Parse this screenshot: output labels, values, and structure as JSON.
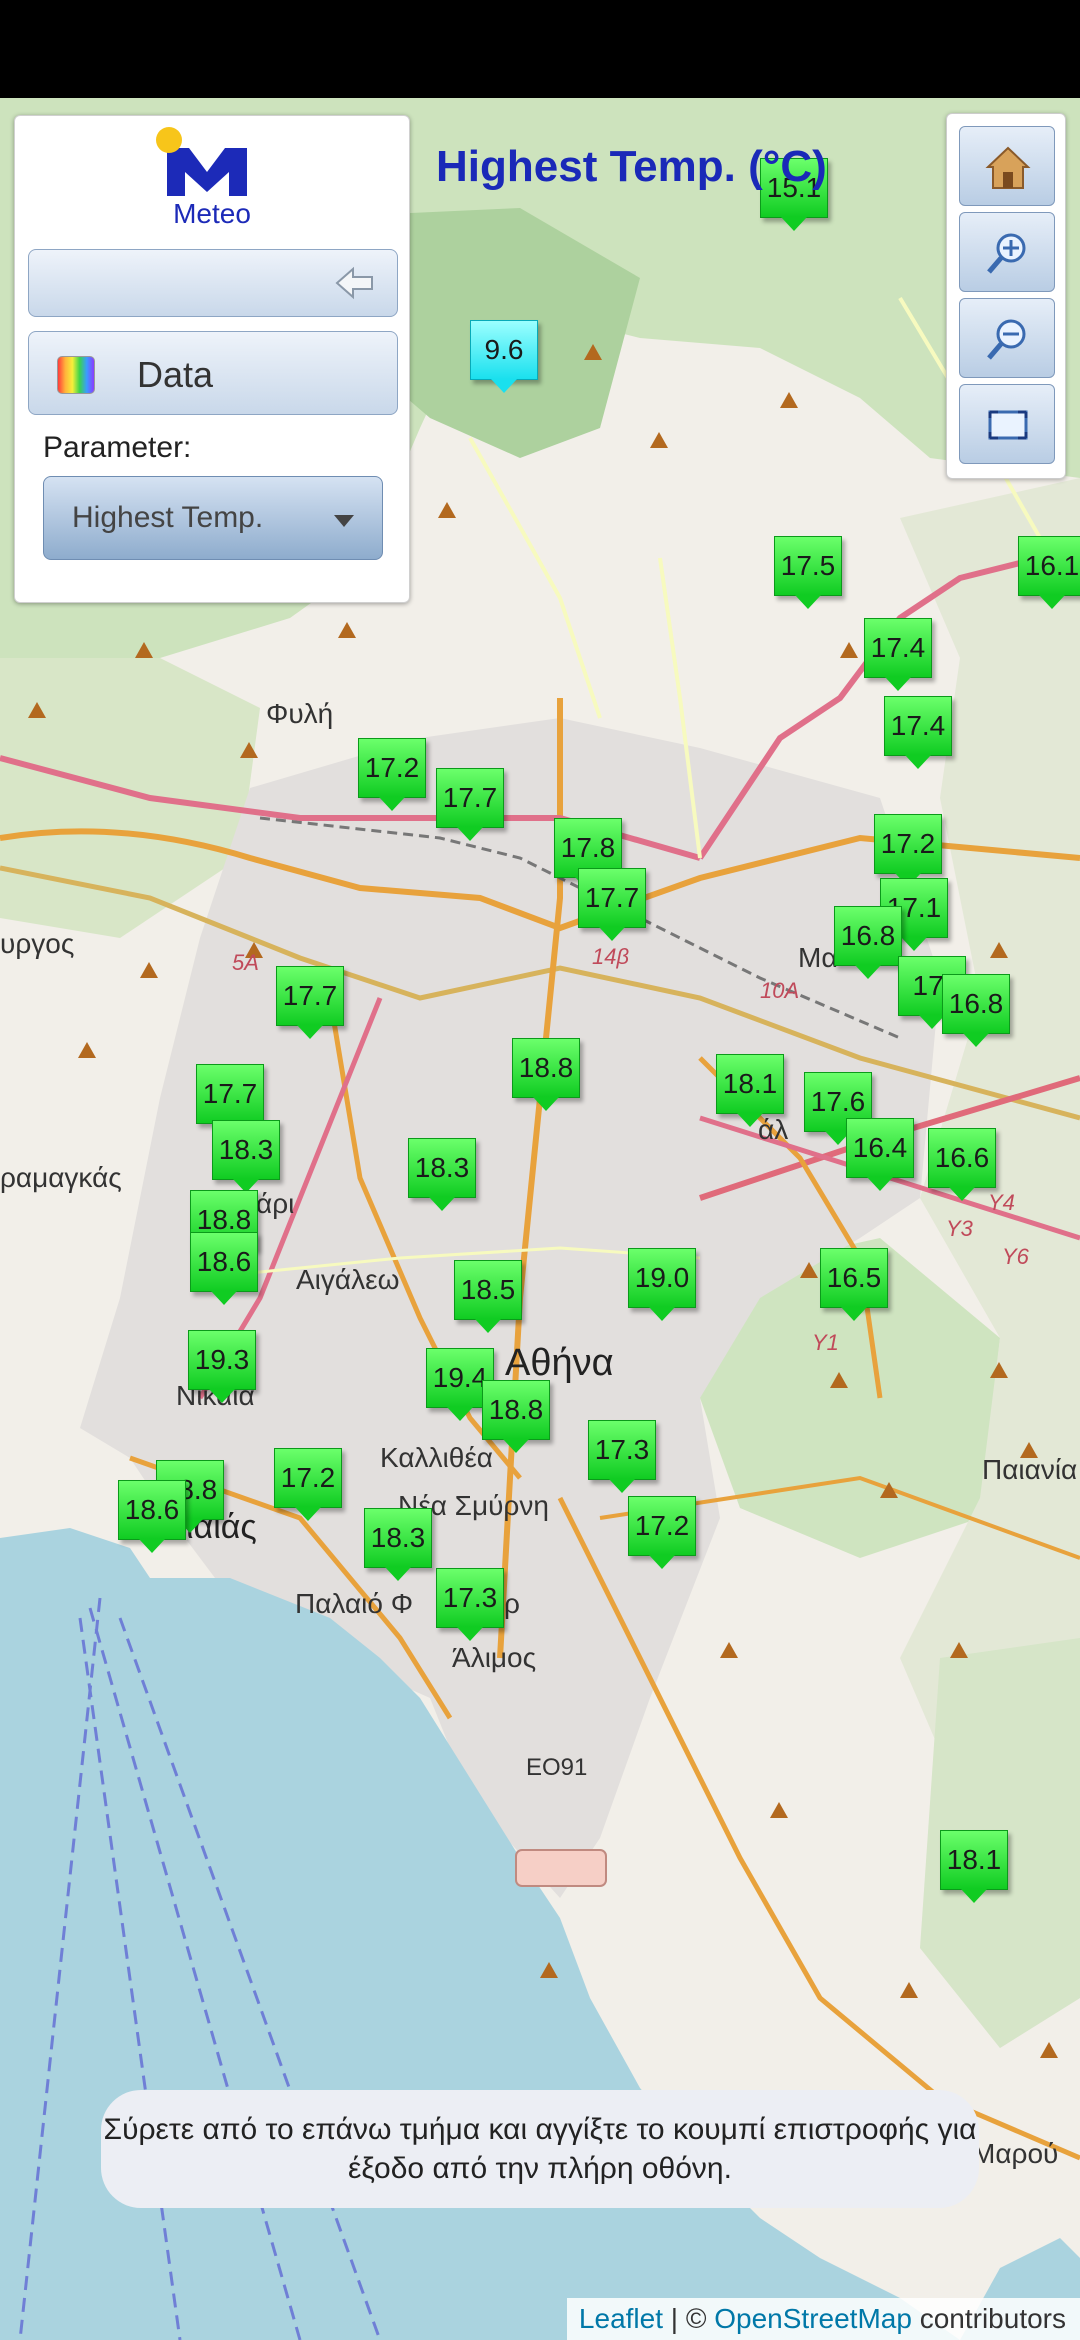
{
  "panel": {
    "logo_text": "Meteo",
    "data_label": "Data",
    "parameter_label": "Parameter:",
    "parameter_value": "Highest Temp."
  },
  "map_title": "Highest Temp. (°C)",
  "place_labels": [
    "Φυλή",
    "Αιγάλεω",
    "Αθήνα",
    "Καλλιθέα",
    "Νέα Σμύρνη",
    "Παλαιό Φ",
    "ρ",
    "Άλιμος",
    "Νίκαια",
    "Παιανία",
    "Μαρού",
    "ραμαγκάς",
    "υργος",
    "άρι",
    "ιαιάς",
    "Μα",
    "άλ"
  ],
  "road_labels": [
    "EO91",
    "5A",
    "14β",
    "10A",
    "Y1",
    "Y3",
    "Y4",
    "Y6"
  ],
  "stations": [
    {
      "value": "15.1",
      "color": "green"
    },
    {
      "value": "9.6",
      "color": "cyan"
    },
    {
      "value": "17.5",
      "color": "green"
    },
    {
      "value": "16.1",
      "color": "green"
    },
    {
      "value": "17.4",
      "color": "green"
    },
    {
      "value": "17.4",
      "color": "green"
    },
    {
      "value": "17.2",
      "color": "green"
    },
    {
      "value": "17.7",
      "color": "green"
    },
    {
      "value": "17.8",
      "color": "green"
    },
    {
      "value": "17.7",
      "color": "green"
    },
    {
      "value": "17.2",
      "color": "green"
    },
    {
      "value": "17.1",
      "color": "green"
    },
    {
      "value": "16.8",
      "color": "green"
    },
    {
      "value": "17.",
      "color": "green"
    },
    {
      "value": "16.8",
      "color": "green"
    },
    {
      "value": "17.7",
      "color": "green"
    },
    {
      "value": "18.8",
      "color": "green"
    },
    {
      "value": "18.1",
      "color": "green"
    },
    {
      "value": "17.6",
      "color": "green"
    },
    {
      "value": "16.4",
      "color": "green"
    },
    {
      "value": "16.6",
      "color": "green"
    },
    {
      "value": "17.7",
      "color": "green"
    },
    {
      "value": "18.3",
      "color": "green"
    },
    {
      "value": "18.3",
      "color": "green"
    },
    {
      "value": "18.8",
      "color": "green"
    },
    {
      "value": "18.6",
      "color": "green"
    },
    {
      "value": "18.5",
      "color": "green"
    },
    {
      "value": "19.0",
      "color": "green"
    },
    {
      "value": "16.5",
      "color": "green"
    },
    {
      "value": "19.3",
      "color": "green"
    },
    {
      "value": "19.4",
      "color": "green"
    },
    {
      "value": "18.8",
      "color": "green"
    },
    {
      "value": "17.3",
      "color": "green"
    },
    {
      "value": "17.2",
      "color": "green"
    },
    {
      "value": "18.8",
      "color": "green"
    },
    {
      "value": "18.6",
      "color": "green"
    },
    {
      "value": "17.2",
      "color": "green"
    },
    {
      "value": "18.3",
      "color": "green"
    },
    {
      "value": "17.3",
      "color": "green"
    },
    {
      "value": "18.1",
      "color": "green"
    }
  ],
  "toast_text": "Σύρετε από το επάνω τμήμα και αγγίξτε το κουμπί επιστροφής για έξοδο από την πλήρη οθόνη.",
  "attribution": {
    "leaflet": "Leaflet",
    "separator": " | © ",
    "osm": "OpenStreetMap",
    "contributors": " contributors"
  },
  "colors": {
    "title": "#1a29b8",
    "marker_green": "#10cc22",
    "marker_cyan": "#1ae0ee",
    "sea": "#aad3df",
    "forest": "#add19e"
  }
}
